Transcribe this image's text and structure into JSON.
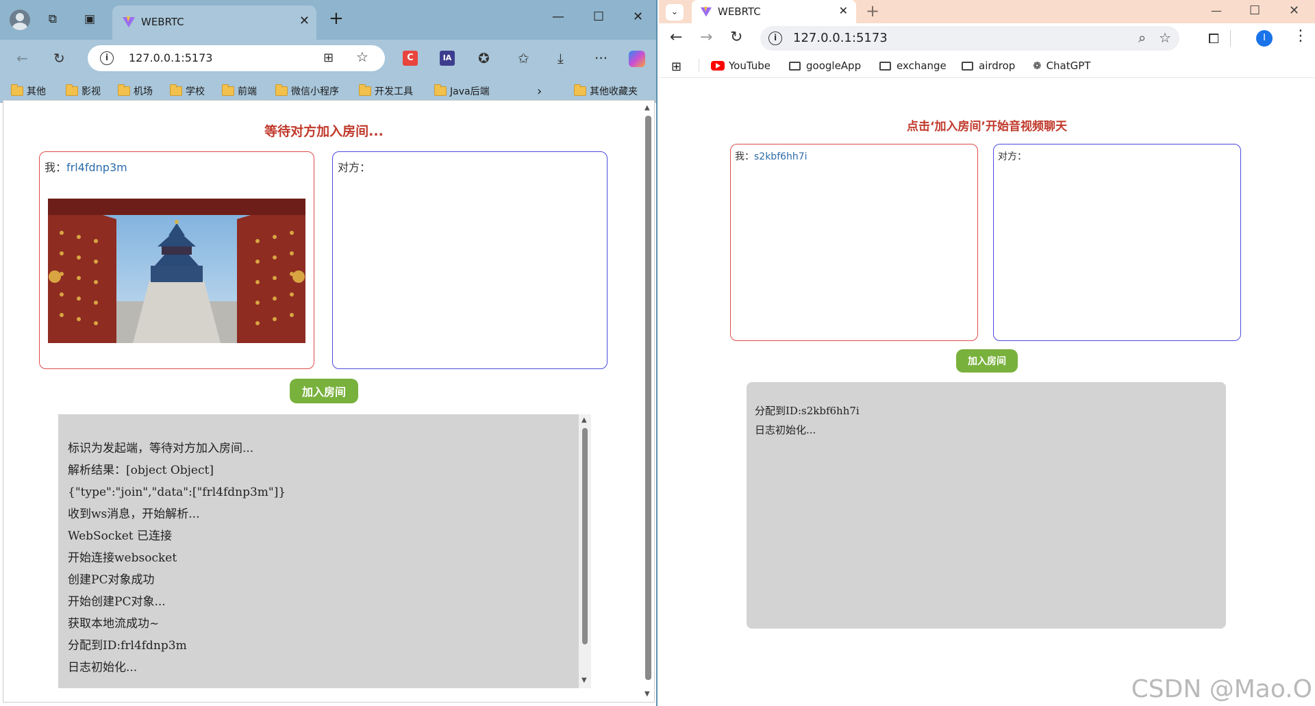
{
  "left_window": {
    "tab": {
      "title": "WEBRTC",
      "close": "✕"
    },
    "window_controls": {
      "minimize": "—",
      "maximize": "☐",
      "close": "✕"
    },
    "address": {
      "url": "127.0.0.1:5173"
    },
    "extensions": [
      {
        "label": "C",
        "color": "#e8453c"
      },
      {
        "label": "IA",
        "color": "#3d3d8f"
      }
    ],
    "bookmarks": [
      "其他",
      "影视",
      "机场",
      "学校",
      "前端",
      "微信小程序",
      "开发工具",
      "Java后端"
    ],
    "other_bookmarks": "其他收藏夹",
    "page": {
      "title": "等待对方加入房间...",
      "me_label": "我：",
      "me_id": "frl4fdnp3m",
      "peer_label": "对方：",
      "join_button": "加入房间",
      "log": [
        "标识为发起端，等待对方加入房间...",
        "解析结果：[object Object]",
        "{\"type\":\"join\",\"data\":[\"frl4fdnp3m\"]}",
        "收到ws消息，开始解析...",
        "WebSocket 已连接",
        "开始连接websocket",
        "创建PC对象成功",
        "开始创建PC对象...",
        "获取本地流成功~",
        "分配到ID:frl4fdnp3m",
        "日志初始化..."
      ]
    }
  },
  "right_window": {
    "tab": {
      "title": "WEBRTC",
      "close": "✕"
    },
    "window_controls": {
      "minimize": "—",
      "maximize": "☐",
      "close": "✕"
    },
    "address": {
      "url": "127.0.0.1:5173"
    },
    "profile_initial": "I",
    "bookmarks": [
      "YouTube",
      "googleApp",
      "exchange",
      "airdrop",
      "ChatGPT"
    ],
    "page": {
      "title": "点击‘加入房间’开始音视频聊天",
      "me_label": "我：",
      "me_id": "s2kbf6hh7i",
      "peer_label": "对方：",
      "join_button": "加入房间",
      "log": [
        "分配到ID:s2kbf6hh7i",
        "日志初始化..."
      ]
    }
  },
  "watermark": "CSDN @Mao.O",
  "colors": {
    "title_red": "#c0392b",
    "button_green": "#79b13d",
    "me_border": "#e04a4a",
    "peer_border": "#4a4ae0",
    "log_bg": "#d3d3d3"
  }
}
